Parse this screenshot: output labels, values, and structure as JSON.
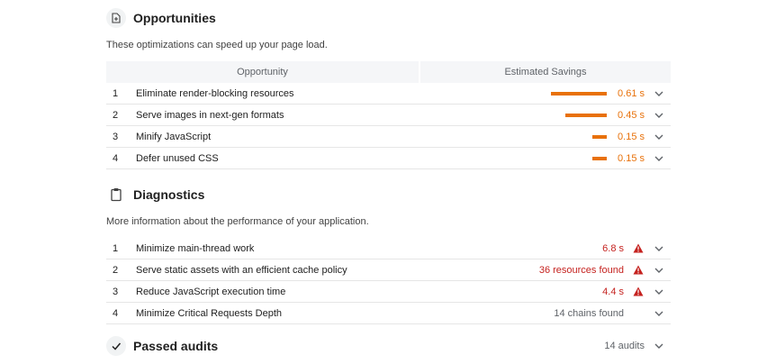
{
  "opportunities": {
    "title": "Opportunities",
    "description": "These optimizations can speed up your page load.",
    "col_opportunity": "Opportunity",
    "col_savings": "Estimated Savings",
    "items": [
      {
        "index": "1",
        "title": "Eliminate render-blocking resources",
        "savings": "0.61 s",
        "bar_fraction": 1.0
      },
      {
        "index": "2",
        "title": "Serve images in next-gen formats",
        "savings": "0.45 s",
        "bar_fraction": 0.74
      },
      {
        "index": "3",
        "title": "Minify JavaScript",
        "savings": "0.15 s",
        "bar_fraction": 0.25
      },
      {
        "index": "4",
        "title": "Defer unused CSS",
        "savings": "0.15 s",
        "bar_fraction": 0.25
      }
    ]
  },
  "diagnostics": {
    "title": "Diagnostics",
    "description": "More information about the performance of your application.",
    "items": [
      {
        "index": "1",
        "title": "Minimize main-thread work",
        "value": "6.8 s",
        "warning": true
      },
      {
        "index": "2",
        "title": "Serve static assets with an efficient cache policy",
        "value": "36 resources found",
        "warning": true
      },
      {
        "index": "3",
        "title": "Reduce JavaScript execution time",
        "value": "4.4 s",
        "warning": true
      },
      {
        "index": "4",
        "title": "Minimize Critical Requests Depth",
        "value": "14 chains found",
        "warning": false
      }
    ]
  },
  "passed": {
    "title": "Passed audits",
    "count": "14 audits"
  },
  "colors": {
    "savings": "#e8710a",
    "warning": "#c5221f",
    "neutral": "#5f6368"
  }
}
